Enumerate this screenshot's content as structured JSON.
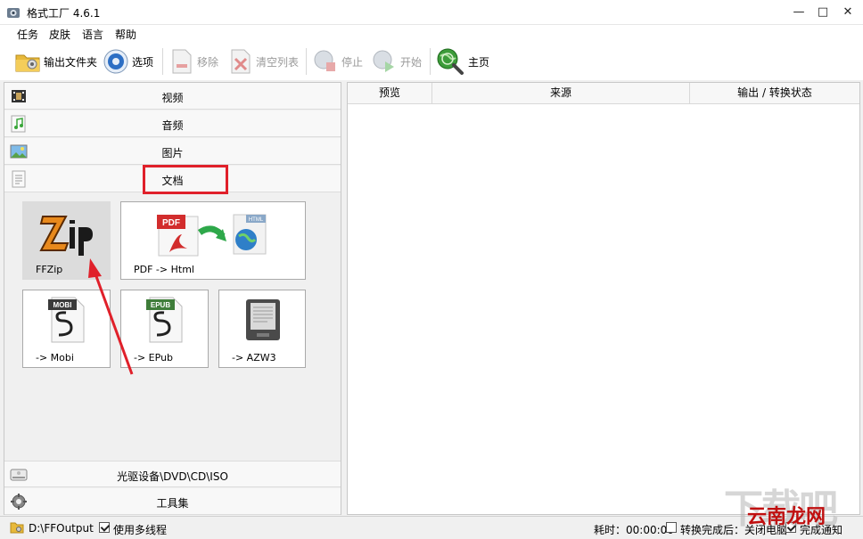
{
  "window": {
    "title": "格式工厂 4.6.1"
  },
  "menu": {
    "items": [
      "任务",
      "皮肤",
      "语言",
      "帮助"
    ]
  },
  "toolbar": {
    "output_folder": "输出文件夹",
    "options": "选项",
    "remove": "移除",
    "clear_list": "清空列表",
    "stop": "停止",
    "start": "开始",
    "home": "主页"
  },
  "categories": {
    "video": "视频",
    "audio": "音频",
    "image": "图片",
    "document": "文档",
    "disc": "光驱设备\\DVD\\CD\\ISO",
    "tools": "工具集"
  },
  "tiles": {
    "ffzip": "FFZip",
    "pdf_html": "PDF -> Html",
    "mobi": "-> Mobi",
    "epub": "-> EPub",
    "azw3": "-> AZW3",
    "pdf_badge": "PDF",
    "html_badge": "HTML",
    "mobi_badge": "MOBI",
    "epub_badge": "EPUB"
  },
  "columns": {
    "preview": "预览",
    "source": "来源",
    "status": "输出 / 转换状态"
  },
  "status": {
    "output_path": "D:\\FFOutput",
    "multithread": "使用多线程",
    "elapsed": "耗时：00:00:00",
    "after_convert": "转换完成后：关闭电脑",
    "notify": "完成通知"
  },
  "watermark": {
    "big": "下载吧",
    "small": "云南龙网"
  },
  "colors": {
    "accent_red": "#e0202a"
  }
}
